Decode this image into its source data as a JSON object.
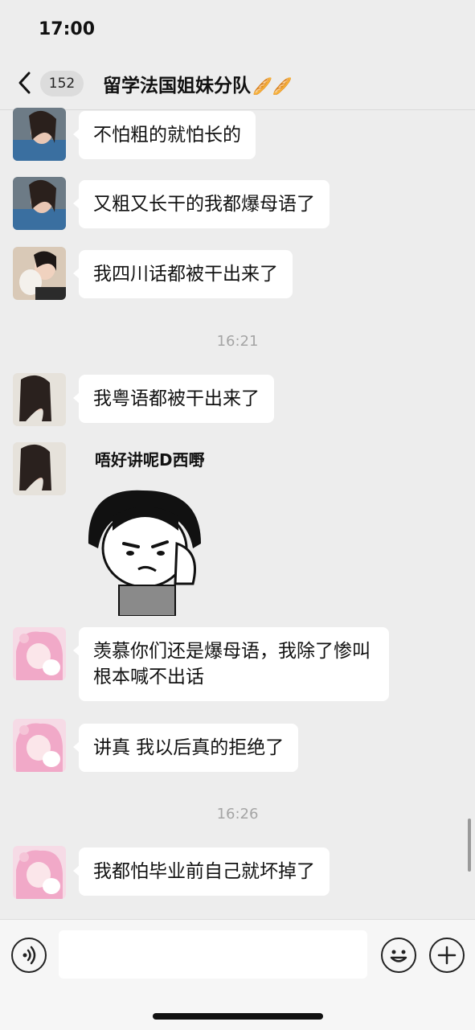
{
  "status": {
    "time": "17:00"
  },
  "nav": {
    "unread_count": "152",
    "title": "留学法国姐妹分队",
    "title_emoji": "🥖🥖"
  },
  "messages": [
    {
      "text": "不怕粗的就怕长的"
    },
    {
      "text": "又粗又长干的我都爆母语了"
    },
    {
      "text": "我四川话都被干出来了"
    },
    {
      "text": "我粤语都被干出来了"
    },
    {
      "sticker_caption": "唔好讲呢D西嘢"
    },
    {
      "text": "羡慕你们还是爆母语，我除了惨叫根本喊不出话"
    },
    {
      "text": "讲真 我以后真的拒绝了"
    },
    {
      "text": "我都怕毕业前自己就坏掉了"
    }
  ],
  "timestamps": [
    "16:21",
    "16:26"
  ],
  "input": {
    "value": "",
    "placeholder": ""
  },
  "colors": {
    "background": "#ededed",
    "bubble": "#ffffff",
    "timestamp": "#a5a5a5"
  },
  "icons": [
    "back-chevron-icon",
    "voice-icon",
    "emoji-icon",
    "plus-icon"
  ]
}
